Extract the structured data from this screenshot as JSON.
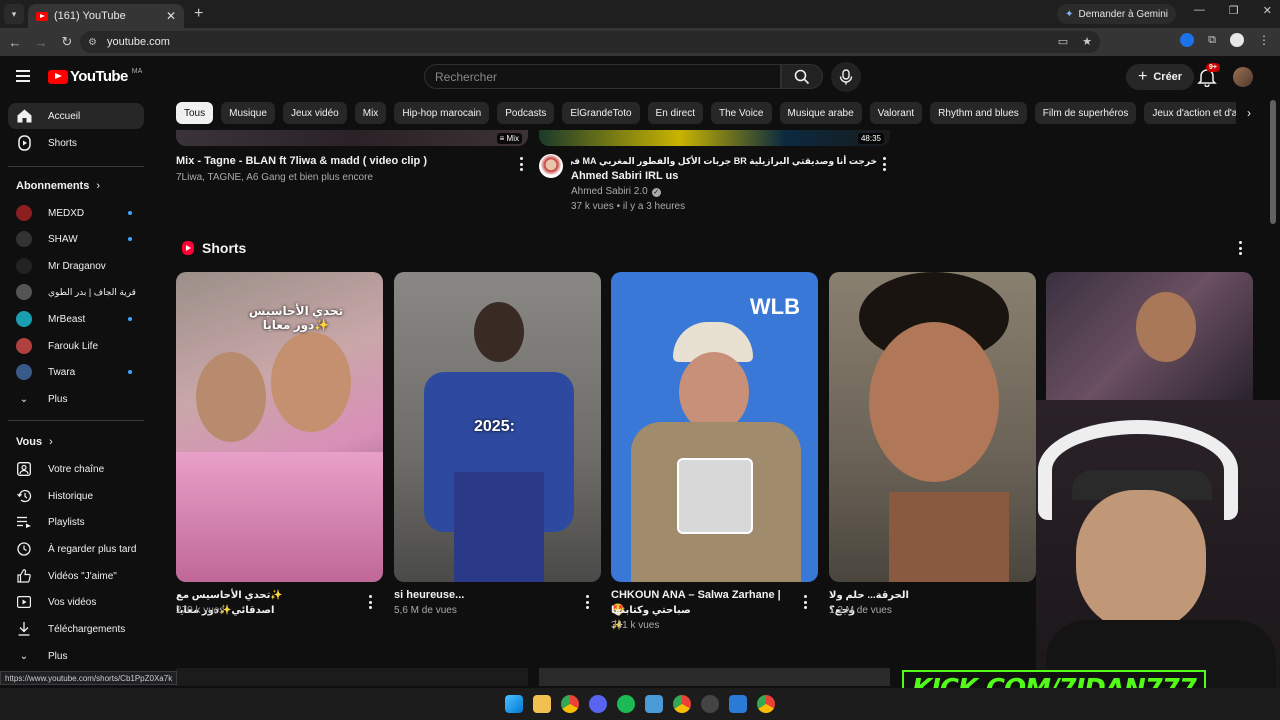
{
  "browser": {
    "tab_title": "(161) YouTube",
    "url": "youtube.com",
    "gemini_label": "Demander à Gemini",
    "hover_link": "https://www.youtube.com/shorts/Cb1PpZ0Xa7k"
  },
  "header": {
    "logo_text": "YouTube",
    "country_code": "MA",
    "search_placeholder": "Rechercher",
    "create_label": "Créer",
    "notifications_badge": "9+"
  },
  "sidebar": {
    "main": [
      {
        "label": "Accueil"
      },
      {
        "label": "Shorts"
      }
    ],
    "subscriptions_heading": "Abonnements",
    "subscriptions": [
      {
        "label": "MEDXD",
        "color": "#8b1e1e"
      },
      {
        "label": "SHAW",
        "color": "#333333"
      },
      {
        "label": "Mr Draganov",
        "color": "#222222"
      },
      {
        "label": "قرية الجاف | بدر الطوي",
        "color": "#555555"
      },
      {
        "label": "MrBeast",
        "color": "#1a9fb0"
      },
      {
        "label": "Farouk Life",
        "color": "#b04040"
      },
      {
        "label": "Twara",
        "color": "#3a5a8a"
      }
    ],
    "subs_more": "Plus",
    "you_heading": "Vous",
    "you_items": [
      {
        "label": "Votre chaîne"
      },
      {
        "label": "Historique"
      },
      {
        "label": "Playlists"
      },
      {
        "label": "À regarder plus tard"
      },
      {
        "label": "Vidéos \"J'aime\""
      },
      {
        "label": "Vos vidéos"
      },
      {
        "label": "Téléchargements"
      },
      {
        "label": "Plus"
      }
    ]
  },
  "chips": [
    "Tous",
    "Musique",
    "Jeux vidéo",
    "Mix",
    "Hip-hop marocain",
    "Podcasts",
    "ElGrandeToto",
    "En direct",
    "The Voice",
    "Musique arabe",
    "Valorant",
    "Rhythm and blues",
    "Film de superhéros",
    "Jeux d'action et d'aventure"
  ],
  "videos": [
    {
      "title": "Mix - Tagne - BLAN ft 7liwa & madd ( video clip )",
      "meta": "7Liwa, TAGNE, A6 Gang et bien plus encore",
      "badge": "Mix"
    },
    {
      "title_line1": "خرجت أنا وصديقتي البرازيلية BR جربات الأكل والفطور المغربي MA في نيويورك 🥰 |",
      "title_line2": "Ahmed Sabiri IRL us",
      "channel": "Ahmed Sabiri 2.0",
      "meta": "37 k vues • il y a 3 heures",
      "duration": "48:35"
    }
  ],
  "shorts": {
    "heading": "Shorts",
    "items": [
      {
        "title": "✨تحدي الأحاسيس مع اصدقائي✨دور معايا",
        "views": "270 k vues"
      },
      {
        "title": "si heureuse...",
        "views": "5,6 M de vues"
      },
      {
        "title_line1": "CHKOUN ANA – Salwa Zarhane | 🤩",
        "title_line2": "صباحتي وكتابتها ✨",
        "views": "341 k vues"
      },
      {
        "title": "الحرقة... حلم ولا وجع؟",
        "views": "1,2 M de vues"
      }
    ],
    "overlay_texts": {
      "short1": "تحدي الأحاسيس\nدور معايا✨",
      "short2": "2025:",
      "short3_brand": "WLB"
    }
  },
  "watermark": "KICK.COM/7IDAN777",
  "colors": {
    "youtube_red": "#ff0000",
    "kick_green": "#53fc18",
    "background": "#0f0f0f"
  }
}
